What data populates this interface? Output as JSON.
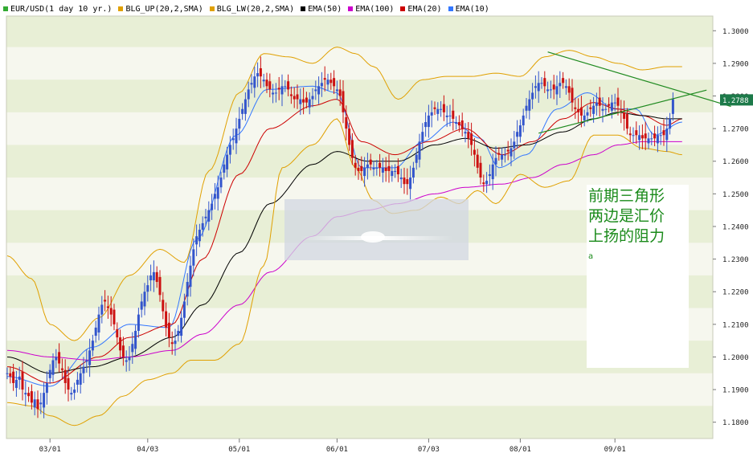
{
  "legend": [
    {
      "label": "EUR/USD(1 day  10 yr.)",
      "color": "#33aa33"
    },
    {
      "label": "BLG_UP(20,2,SMA)",
      "color": "#e0a000"
    },
    {
      "label": "BLG_LW(20,2,SMA)",
      "color": "#e0a000"
    },
    {
      "label": "EMA(50)",
      "color": "#000000"
    },
    {
      "label": "EMA(100)",
      "color": "#cc00cc"
    },
    {
      "label": "EMA(20)",
      "color": "#cc0000"
    },
    {
      "label": "EMA(10)",
      "color": "#3377ff"
    }
  ],
  "annotation": {
    "lines": [
      "前期三角形",
      "两边是汇价",
      "上扬的阻力"
    ],
    "marker": "a"
  },
  "chart_data": {
    "type": "line",
    "title": "",
    "instrument": "EUR/USD",
    "xlabel": "",
    "ylabel": "",
    "ylim": [
      1.175,
      1.3045
    ],
    "yticks": [
      1.18,
      1.19,
      1.2,
      1.21,
      1.22,
      1.23,
      1.24,
      1.25,
      1.26,
      1.27,
      1.28,
      1.29,
      1.3
    ],
    "ytick_labels": [
      "1.1800",
      "1.1900",
      "1.2000",
      "1.2100",
      "1.2200",
      "1.2300",
      "1.2400",
      "1.2500",
      "1.2600",
      "1.2700",
      "1.2800",
      "1.2900",
      "1.3000"
    ],
    "xticks": [
      {
        "label": "03/01",
        "bar": 14
      },
      {
        "label": "04/03",
        "bar": 46
      },
      {
        "label": "05/01",
        "bar": 76
      },
      {
        "label": "06/01",
        "bar": 108
      },
      {
        "label": "07/03",
        "bar": 138
      },
      {
        "label": "08/01",
        "bar": 168
      },
      {
        "label": "09/01",
        "bar": 199
      }
    ],
    "last_price_label": "1.2788",
    "last_price": 1.2788,
    "bar_count": 222,
    "candles": {
      "close": [
        1.195,
        1.194,
        1.192,
        1.193,
        1.194,
        1.19,
        1.189,
        1.188,
        1.186,
        1.187,
        1.184,
        1.186,
        1.189,
        1.192,
        1.196,
        1.199,
        1.2,
        1.198,
        1.196,
        1.192,
        1.19,
        1.189,
        1.19,
        1.193,
        1.195,
        1.197,
        1.199,
        1.202,
        1.205,
        1.209,
        1.213,
        1.216,
        1.217,
        1.215,
        1.213,
        1.21,
        1.206,
        1.202,
        1.2,
        1.199,
        1.2,
        1.204,
        1.208,
        1.213,
        1.217,
        1.22,
        1.222,
        1.225,
        1.226,
        1.223,
        1.219,
        1.214,
        1.209,
        1.206,
        1.204,
        1.205,
        1.208,
        1.212,
        1.217,
        1.223,
        1.228,
        1.233,
        1.237,
        1.239,
        1.241,
        1.243,
        1.245,
        1.247,
        1.25,
        1.252,
        1.255,
        1.259,
        1.262,
        1.265,
        1.267,
        1.27,
        1.273,
        1.276,
        1.279,
        1.282,
        1.284,
        1.286,
        1.287,
        1.286,
        1.285,
        1.283,
        1.282,
        1.281,
        1.281,
        1.282,
        1.283,
        1.283,
        1.282,
        1.28,
        1.279,
        1.279,
        1.279,
        1.278,
        1.278,
        1.279,
        1.28,
        1.282,
        1.283,
        1.284,
        1.285,
        1.285,
        1.284,
        1.283,
        1.282,
        1.28,
        1.275,
        1.27,
        1.265,
        1.261,
        1.258,
        1.257,
        1.257,
        1.258,
        1.259,
        1.259,
        1.258,
        1.258,
        1.258,
        1.258,
        1.257,
        1.257,
        1.257,
        1.257,
        1.256,
        1.255,
        1.253,
        1.253,
        1.255,
        1.258,
        1.262,
        1.266,
        1.269,
        1.272,
        1.274,
        1.275,
        1.276,
        1.276,
        1.276,
        1.275,
        1.274,
        1.274,
        1.273,
        1.272,
        1.271,
        1.27,
        1.269,
        1.267,
        1.265,
        1.262,
        1.258,
        1.255,
        1.253,
        1.254,
        1.256,
        1.259,
        1.261,
        1.262,
        1.262,
        1.262,
        1.263,
        1.264,
        1.266,
        1.269,
        1.271,
        1.274,
        1.277,
        1.279,
        1.281,
        1.283,
        1.284,
        1.284,
        1.283,
        1.282,
        1.282,
        1.282,
        1.283,
        1.284,
        1.284,
        1.283,
        1.281,
        1.278,
        1.276,
        1.275,
        1.274,
        1.274,
        1.275,
        1.276,
        1.277,
        1.278,
        1.277,
        1.276,
        1.276,
        1.277,
        1.278,
        1.278,
        1.277,
        1.275,
        1.273,
        1.27,
        1.268,
        1.268,
        1.268,
        1.268,
        1.267,
        1.267,
        1.267,
        1.267,
        1.267,
        1.268,
        1.268,
        1.268,
        1.27,
        1.273,
        1.279
      ],
      "swing": [
        0.003,
        0.0035,
        0.004,
        0.0045,
        0.005,
        0.0055,
        0.006
      ]
    },
    "indicators": [
      {
        "name": "EMA(10)",
        "color": "#3377ff",
        "knots": [
          [
            0,
            1.194
          ],
          [
            14,
            1.191
          ],
          [
            28,
            1.203
          ],
          [
            40,
            1.21
          ],
          [
            53,
            1.209
          ],
          [
            62,
            1.236
          ],
          [
            75,
            1.268
          ],
          [
            85,
            1.282
          ],
          [
            100,
            1.283
          ],
          [
            108,
            1.281
          ],
          [
            116,
            1.258
          ],
          [
            127,
            1.258
          ],
          [
            136,
            1.266
          ],
          [
            146,
            1.272
          ],
          [
            155,
            1.267
          ],
          [
            161,
            1.258
          ],
          [
            170,
            1.262
          ],
          [
            180,
            1.276
          ],
          [
            190,
            1.281
          ],
          [
            199,
            1.276
          ],
          [
            206,
            1.276
          ],
          [
            212,
            1.268
          ],
          [
            221,
            1.272
          ]
        ]
      },
      {
        "name": "EMA(20)",
        "color": "#cc0000",
        "knots": [
          [
            0,
            1.197
          ],
          [
            14,
            1.192
          ],
          [
            30,
            1.2
          ],
          [
            40,
            1.206
          ],
          [
            54,
            1.21
          ],
          [
            64,
            1.23
          ],
          [
            76,
            1.256
          ],
          [
            86,
            1.27
          ],
          [
            100,
            1.277
          ],
          [
            108,
            1.279
          ],
          [
            116,
            1.266
          ],
          [
            127,
            1.262
          ],
          [
            138,
            1.266
          ],
          [
            150,
            1.27
          ],
          [
            162,
            1.262
          ],
          [
            172,
            1.266
          ],
          [
            182,
            1.273
          ],
          [
            192,
            1.278
          ],
          [
            200,
            1.276
          ],
          [
            208,
            1.274
          ],
          [
            216,
            1.271
          ],
          [
            221,
            1.273
          ]
        ]
      },
      {
        "name": "EMA(50)",
        "color": "#000000",
        "knots": [
          [
            0,
            1.2
          ],
          [
            14,
            1.195
          ],
          [
            28,
            1.197
          ],
          [
            40,
            1.2
          ],
          [
            54,
            1.206
          ],
          [
            64,
            1.216
          ],
          [
            76,
            1.232
          ],
          [
            86,
            1.247
          ],
          [
            100,
            1.259
          ],
          [
            108,
            1.263
          ],
          [
            118,
            1.26
          ],
          [
            128,
            1.26
          ],
          [
            140,
            1.265
          ],
          [
            150,
            1.267
          ],
          [
            160,
            1.264
          ],
          [
            170,
            1.265
          ],
          [
            182,
            1.269
          ],
          [
            192,
            1.273
          ],
          [
            200,
            1.275
          ],
          [
            208,
            1.274
          ],
          [
            216,
            1.273
          ],
          [
            221,
            1.273
          ]
        ]
      },
      {
        "name": "EMA(100)",
        "color": "#cc00cc",
        "knots": [
          [
            0,
            1.202
          ],
          [
            14,
            1.2
          ],
          [
            28,
            1.199
          ],
          [
            40,
            1.2
          ],
          [
            54,
            1.202
          ],
          [
            64,
            1.207
          ],
          [
            76,
            1.216
          ],
          [
            86,
            1.226
          ],
          [
            100,
            1.237
          ],
          [
            108,
            1.243
          ],
          [
            118,
            1.245
          ],
          [
            128,
            1.247
          ],
          [
            140,
            1.25
          ],
          [
            150,
            1.252
          ],
          [
            162,
            1.253
          ],
          [
            172,
            1.255
          ],
          [
            182,
            1.259
          ],
          [
            192,
            1.262
          ],
          [
            200,
            1.265
          ],
          [
            208,
            1.266
          ],
          [
            216,
            1.266
          ],
          [
            221,
            1.266
          ]
        ]
      },
      {
        "name": "BLG_UP(20,2,SMA)",
        "color": "#e0a000",
        "knots": [
          [
            0,
            1.231
          ],
          [
            8,
            1.224
          ],
          [
            14,
            1.21
          ],
          [
            22,
            1.205
          ],
          [
            30,
            1.212
          ],
          [
            40,
            1.225
          ],
          [
            50,
            1.233
          ],
          [
            58,
            1.229
          ],
          [
            66,
            1.257
          ],
          [
            76,
            1.281
          ],
          [
            84,
            1.293
          ],
          [
            92,
            1.292
          ],
          [
            100,
            1.29
          ],
          [
            108,
            1.295
          ],
          [
            114,
            1.293
          ],
          [
            120,
            1.289
          ],
          [
            128,
            1.279
          ],
          [
            136,
            1.285
          ],
          [
            144,
            1.286
          ],
          [
            152,
            1.286
          ],
          [
            160,
            1.287
          ],
          [
            168,
            1.286
          ],
          [
            176,
            1.292
          ],
          [
            184,
            1.294
          ],
          [
            192,
            1.292
          ],
          [
            200,
            1.29
          ],
          [
            208,
            1.288
          ],
          [
            216,
            1.289
          ],
          [
            221,
            1.289
          ]
        ]
      },
      {
        "name": "BLG_LW(20,2,SMA)",
        "color": "#e0a000",
        "knots": [
          [
            0,
            1.186
          ],
          [
            8,
            1.185
          ],
          [
            14,
            1.182
          ],
          [
            22,
            1.179
          ],
          [
            30,
            1.182
          ],
          [
            38,
            1.188
          ],
          [
            46,
            1.193
          ],
          [
            54,
            1.195
          ],
          [
            60,
            1.199
          ],
          [
            68,
            1.199
          ],
          [
            76,
            1.204
          ],
          [
            84,
            1.228
          ],
          [
            90,
            1.258
          ],
          [
            100,
            1.265
          ],
          [
            108,
            1.273
          ],
          [
            114,
            1.258
          ],
          [
            120,
            1.248
          ],
          [
            126,
            1.244
          ],
          [
            134,
            1.245
          ],
          [
            142,
            1.249
          ],
          [
            148,
            1.247
          ],
          [
            154,
            1.251
          ],
          [
            160,
            1.247
          ],
          [
            168,
            1.256
          ],
          [
            176,
            1.252
          ],
          [
            184,
            1.254
          ],
          [
            192,
            1.268
          ],
          [
            200,
            1.268
          ],
          [
            208,
            1.264
          ],
          [
            216,
            1.263
          ],
          [
            221,
            1.262
          ]
        ]
      }
    ],
    "trendlines": [
      {
        "color": "#1f8a1f",
        "from": {
          "bar": 177,
          "price": 1.2935
        },
        "to": {
          "bar": 237,
          "price": 1.2768
        }
      },
      {
        "color": "#1f8a1f",
        "from": {
          "bar": 174,
          "price": 1.2686
        },
        "to": {
          "bar": 229,
          "price": 1.2818
        }
      }
    ]
  }
}
